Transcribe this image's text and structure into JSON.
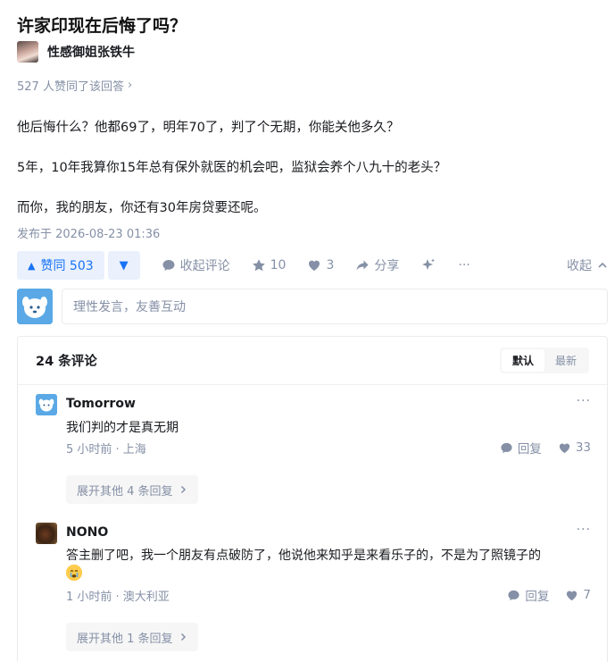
{
  "question": {
    "title": "许家印现在后悔了吗？"
  },
  "author": {
    "name": "性感御姐张铁牛"
  },
  "votes_line": {
    "text": "527 人赞同了该回答",
    "arrow": "›"
  },
  "answer": {
    "paragraphs": [
      "他后悔什么？他都69了，明年70了，判了个无期，你能关他多久？",
      "5年，10年我算你15年总有保外就医的机会吧，监狱会养个八九十的老头？",
      "而你，我的朋友，你还有30年房贷要还呢。"
    ],
    "published": "发布于 2026-08-23 01:36"
  },
  "actions": {
    "agree_label": "赞同 503",
    "agree_icon": "▲",
    "downvote_icon": "▼",
    "comment_label": "收起评论",
    "star_label": "10",
    "like_label": "3",
    "share_label": "分享",
    "more_icon": "···",
    "collapse_label": "收起",
    "collapse_icon": "⌃"
  },
  "composer": {
    "placeholder": "理性发言，友善互动"
  },
  "comments": {
    "count_label": "24 条评论",
    "sort": {
      "default_label": "默认",
      "latest_label": "最新"
    },
    "items": [
      {
        "name": "Tomorrow",
        "text": "我们判的才是真无期",
        "meta": "5 小时前 · 上海",
        "reply_label": "回复",
        "likes": "33",
        "expand_label": "展开其他 4 条回复",
        "more_icon": "···"
      },
      {
        "name": "NONO",
        "text": "答主删了吧，我一个朋友有点破防了，他说他来知乎是来看乐子的，不是为了照镜子的",
        "meta": "1 小时前 · 澳大利亚",
        "reply_label": "回复",
        "likes": "7",
        "expand_label": "展开其他 1 条回复",
        "more_icon": "···"
      }
    ]
  },
  "colors": {
    "accent": "#1772f6",
    "muted": "#8590a6",
    "text": "#191b1f"
  }
}
